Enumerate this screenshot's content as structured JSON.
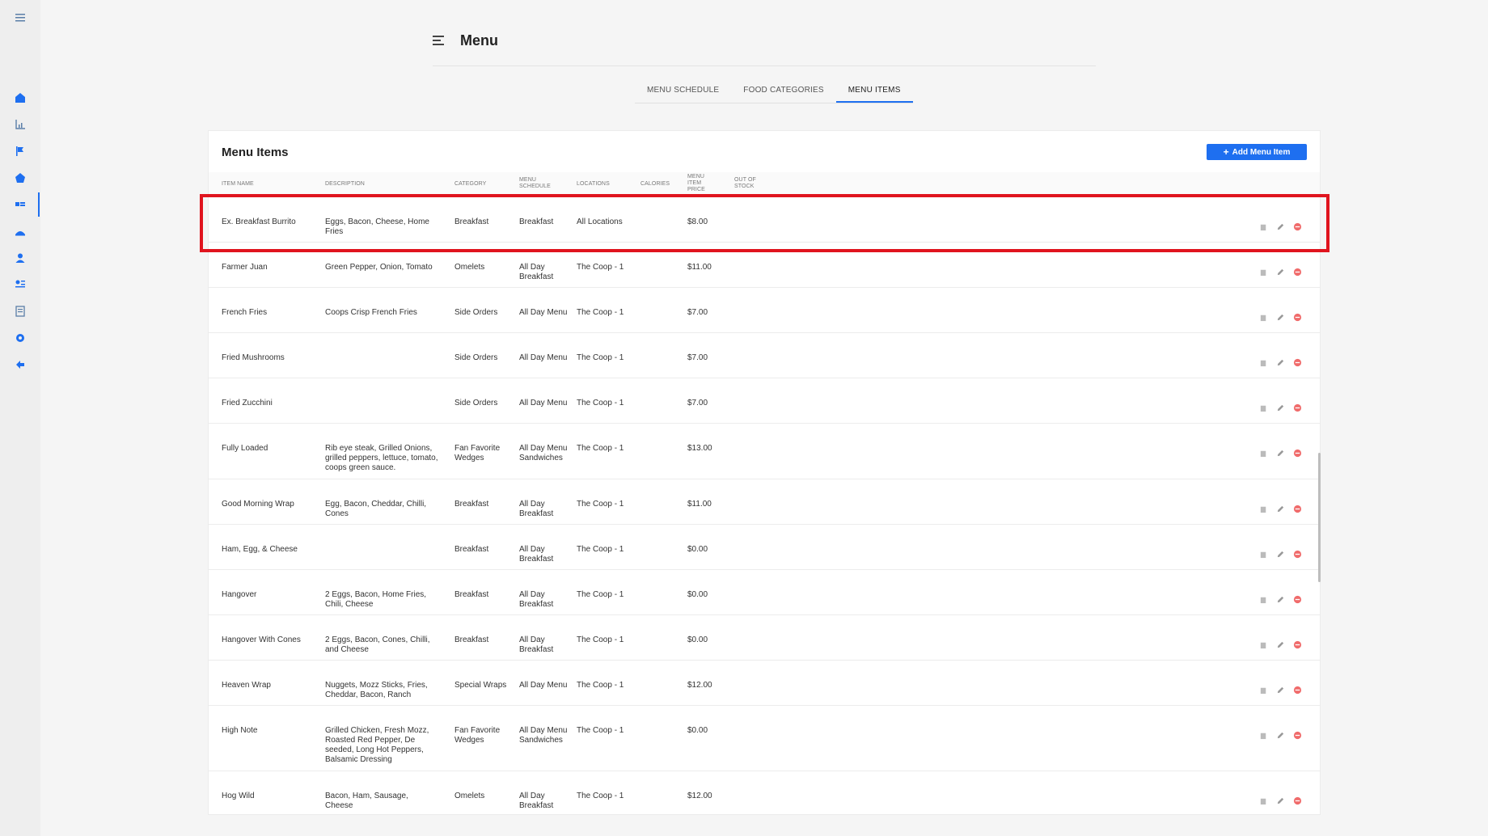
{
  "header": {
    "title": "Menu"
  },
  "tabs": [
    {
      "label": "MENU SCHEDULE",
      "active": false
    },
    {
      "label": "FOOD CATEGORIES",
      "active": false
    },
    {
      "label": "MENU ITEMS",
      "active": true
    }
  ],
  "card": {
    "title": "Menu Items",
    "add_button_label": "Add Menu Item"
  },
  "columns": {
    "item_name": "ITEM NAME",
    "description": "DESCRIPTION",
    "category": "CATEGORY",
    "menu_schedule": "MENU SCHEDULE",
    "locations": "LOCATIONS",
    "calories": "CALORIES",
    "price": "MENU ITEM PRICE",
    "out_of_stock": "OUT OF STOCK"
  },
  "rows": [
    {
      "name": "Ex. Breakfast Burrito",
      "description": "Eggs, Bacon, Cheese, Home Fries",
      "category": "Breakfast",
      "schedule": "Breakfast",
      "location": "All Locations",
      "calories": "",
      "price": "$8.00"
    },
    {
      "name": "Farmer Juan",
      "description": "Green Pepper, Onion, Tomato",
      "category": "Omelets",
      "schedule": "All Day Breakfast",
      "location": "The Coop - 1",
      "calories": "",
      "price": "$11.00"
    },
    {
      "name": "French Fries",
      "description": "Coops Crisp French Fries",
      "category": "Side Orders",
      "schedule": "All Day Menu",
      "location": "The Coop - 1",
      "calories": "",
      "price": "$7.00"
    },
    {
      "name": "Fried Mushrooms",
      "description": "",
      "category": "Side Orders",
      "schedule": "All Day Menu",
      "location": "The Coop - 1",
      "calories": "",
      "price": "$7.00"
    },
    {
      "name": "Fried Zucchini",
      "description": "",
      "category": "Side Orders",
      "schedule": "All Day Menu",
      "location": "The Coop - 1",
      "calories": "",
      "price": "$7.00"
    },
    {
      "name": "Fully Loaded",
      "description": "Rib eye steak, Grilled Onions, grilled peppers, lettuce, tomato, coops green sauce.",
      "category": "Fan Favorite Wedges",
      "schedule": "All Day Menu Sandwiches",
      "location": "The Coop - 1",
      "calories": "",
      "price": "$13.00"
    },
    {
      "name": "Good Morning Wrap",
      "description": "Egg, Bacon, Cheddar, Chilli, Cones",
      "category": "Breakfast",
      "schedule": "All Day Breakfast",
      "location": "The Coop - 1",
      "calories": "",
      "price": "$11.00"
    },
    {
      "name": "Ham, Egg, & Cheese",
      "description": "",
      "category": "Breakfast",
      "schedule": "All Day Breakfast",
      "location": "The Coop - 1",
      "calories": "",
      "price": "$0.00"
    },
    {
      "name": "Hangover",
      "description": "2 Eggs, Bacon, Home Fries, Chili, Cheese",
      "category": "Breakfast",
      "schedule": "All Day Breakfast",
      "location": "The Coop - 1",
      "calories": "",
      "price": "$0.00"
    },
    {
      "name": "Hangover With Cones",
      "description": "2 Eggs, Bacon, Cones, Chilli, and Cheese",
      "category": "Breakfast",
      "schedule": "All Day Breakfast",
      "location": "The Coop - 1",
      "calories": "",
      "price": "$0.00"
    },
    {
      "name": "Heaven Wrap",
      "description": "Nuggets, Mozz Sticks, Fries, Cheddar, Bacon, Ranch",
      "category": "Special Wraps",
      "schedule": "All Day Menu",
      "location": "The Coop - 1",
      "calories": "",
      "price": "$12.00"
    },
    {
      "name": "High Note",
      "description": "Grilled Chicken, Fresh Mozz, Roasted Red Pepper, De seeded, Long Hot Peppers, Balsamic Dressing",
      "category": "Fan Favorite Wedges",
      "schedule": "All Day Menu Sandwiches",
      "location": "The Coop - 1",
      "calories": "",
      "price": "$0.00"
    },
    {
      "name": "Hog Wild",
      "description": "Bacon, Ham, Sausage, Cheese",
      "category": "Omelets",
      "schedule": "All Day Breakfast",
      "location": "The Coop - 1",
      "calories": "",
      "price": "$12.00"
    }
  ],
  "colors": {
    "accent": "#1e6ff0",
    "highlight": "#e0141e",
    "delete": "#f06b6b"
  }
}
